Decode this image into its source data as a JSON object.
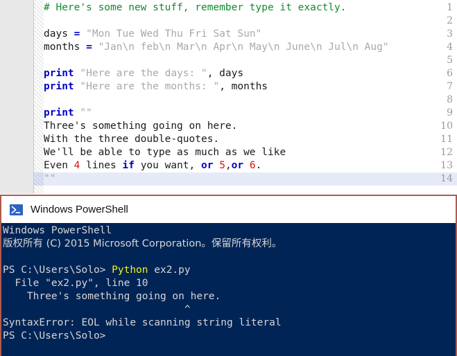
{
  "editor": {
    "name": "code-editor",
    "line_numbers": [
      1,
      2,
      3,
      4,
      5,
      6,
      7,
      8,
      9,
      10,
      11,
      12,
      13,
      14
    ],
    "highlighted_line": 14,
    "colors": {
      "comment": "#128a2e",
      "keyword": "#0000c8",
      "string": "#a8a8a8",
      "number": "#e01010",
      "plain": "#1a1a1a",
      "gutter_bg": "#e8e8e8",
      "current_line_bg": "#e6eaf8"
    },
    "lines": [
      {
        "n": 1,
        "tokens": [
          {
            "t": "# Here's some new stuff, remember type it exactly.",
            "c": "c"
          }
        ]
      },
      {
        "n": 2,
        "tokens": []
      },
      {
        "n": 3,
        "tokens": [
          {
            "t": "days ",
            "c": "p"
          },
          {
            "t": "=",
            "c": "k"
          },
          {
            "t": " ",
            "c": "p"
          },
          {
            "t": "\"Mon Tue Wed Thu Fri Sat Sun\"",
            "c": "s"
          }
        ]
      },
      {
        "n": 4,
        "tokens": [
          {
            "t": "months ",
            "c": "p"
          },
          {
            "t": "=",
            "c": "k"
          },
          {
            "t": " ",
            "c": "p"
          },
          {
            "t": "\"Jan\\n feb\\n Mar\\n Apr\\n May\\n June\\n Jul\\n Aug\"",
            "c": "s"
          }
        ]
      },
      {
        "n": 5,
        "tokens": []
      },
      {
        "n": 6,
        "tokens": [
          {
            "t": "print",
            "c": "k"
          },
          {
            "t": " ",
            "c": "p"
          },
          {
            "t": "\"Here are the days: \"",
            "c": "s"
          },
          {
            "t": ", days",
            "c": "p"
          }
        ]
      },
      {
        "n": 7,
        "tokens": [
          {
            "t": "print",
            "c": "k"
          },
          {
            "t": " ",
            "c": "p"
          },
          {
            "t": "\"Here are the months: \"",
            "c": "s"
          },
          {
            "t": ", months",
            "c": "p"
          }
        ]
      },
      {
        "n": 8,
        "tokens": []
      },
      {
        "n": 9,
        "tokens": [
          {
            "t": "print",
            "c": "k"
          },
          {
            "t": " ",
            "c": "p"
          },
          {
            "t": "\"\"",
            "c": "s"
          }
        ]
      },
      {
        "n": 10,
        "tokens": [
          {
            "t": "Three's something going on here.",
            "c": "p"
          }
        ]
      },
      {
        "n": 11,
        "tokens": [
          {
            "t": "With the three double-quotes.",
            "c": "p"
          }
        ]
      },
      {
        "n": 12,
        "tokens": [
          {
            "t": "We'll be able to type as much as we like",
            "c": "p"
          }
        ]
      },
      {
        "n": 13,
        "tokens": [
          {
            "t": "Even ",
            "c": "p"
          },
          {
            "t": "4",
            "c": "n"
          },
          {
            "t": " lines ",
            "c": "p"
          },
          {
            "t": "if",
            "c": "k"
          },
          {
            "t": " you want, ",
            "c": "p"
          },
          {
            "t": "or",
            "c": "k"
          },
          {
            "t": " ",
            "c": "p"
          },
          {
            "t": "5",
            "c": "n"
          },
          {
            "t": ",",
            "c": "p"
          },
          {
            "t": "or",
            "c": "k"
          },
          {
            "t": " ",
            "c": "p"
          },
          {
            "t": "6",
            "c": "n"
          },
          {
            "t": ".",
            "c": "p"
          }
        ]
      },
      {
        "n": 14,
        "tokens": [
          {
            "t": "\"\"",
            "c": "s"
          }
        ]
      }
    ]
  },
  "console": {
    "title": "Windows PowerShell",
    "icon": "powershell-prompt-icon",
    "background": "#012456",
    "foreground": "#d6d6d6",
    "accent": "#f2f21e",
    "border": "#b05a4e",
    "lines": [
      {
        "segs": [
          {
            "t": "Windows PowerShell"
          }
        ]
      },
      {
        "segs": [
          {
            "t": "版权所有 (C) 2015 Microsoft Corporation。保留所有权利。",
            "cjk": true
          }
        ]
      },
      {
        "segs": []
      },
      {
        "segs": [
          {
            "t": "PS C:\\Users\\Solo> "
          },
          {
            "t": "Python",
            "hl": true
          },
          {
            "t": " ex2.py"
          }
        ]
      },
      {
        "segs": [
          {
            "t": "  File \"ex2.py\", line 10"
          }
        ]
      },
      {
        "segs": [
          {
            "t": "    Three's something going on here."
          }
        ]
      },
      {
        "segs": [
          {
            "t": "                              ^"
          }
        ]
      },
      {
        "segs": [
          {
            "t": "SyntaxError: EOL while scanning string literal"
          }
        ]
      },
      {
        "segs": [
          {
            "t": "PS C:\\Users\\Solo>"
          }
        ]
      }
    ]
  }
}
